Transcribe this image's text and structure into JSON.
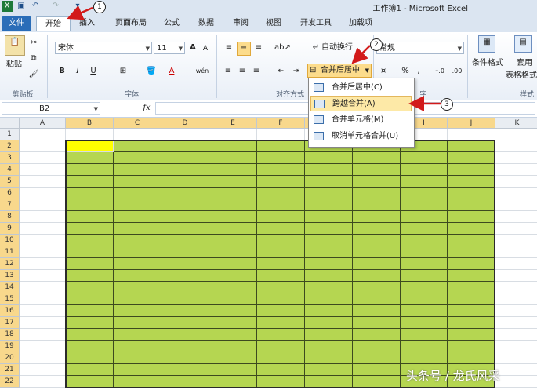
{
  "window": {
    "title": "工作簿1 - Microsoft Excel"
  },
  "tabs": [
    "文件",
    "开始",
    "插入",
    "页面布局",
    "公式",
    "数据",
    "审阅",
    "视图",
    "开发工具",
    "加载项"
  ],
  "clipboard": {
    "paste_label": "粘贴",
    "group_label": "剪贴板"
  },
  "font": {
    "name": "宋体",
    "size": "11",
    "group_label": "字体",
    "bold": "B",
    "italic": "I",
    "underline": "U",
    "grow": "A",
    "shrink": "A",
    "color_a": "A",
    "wen": "wén"
  },
  "alignment": {
    "wrap_label": "自动换行",
    "merge_label": "合并后居中",
    "group_label": "对齐方式"
  },
  "number": {
    "format": "常规",
    "percent": "%",
    "comma": ",",
    "group_label": "字"
  },
  "styles": {
    "cond_label": "条件格式",
    "table_label1": "套用",
    "table_label2": "表格格式",
    "group_label": "样式"
  },
  "formula_bar": {
    "name_box": "B2",
    "fx": "fx"
  },
  "columns": [
    "A",
    "B",
    "C",
    "D",
    "E",
    "F",
    "G",
    "H",
    "I",
    "J",
    "K"
  ],
  "rows": [
    "1",
    "2",
    "3",
    "4",
    "5",
    "6",
    "7",
    "8",
    "9",
    "10",
    "11",
    "12",
    "13",
    "14",
    "15",
    "16",
    "17",
    "18",
    "19",
    "20",
    "21",
    "22"
  ],
  "merge_menu": [
    {
      "label": "合并后居中(C)",
      "highlighted": false
    },
    {
      "label": "跨越合并(A)",
      "highlighted": true
    },
    {
      "label": "合并单元格(M)",
      "highlighted": false
    },
    {
      "label": "取消单元格合并(U)",
      "highlighted": false
    }
  ],
  "callouts": [
    "1",
    "2",
    "3"
  ],
  "watermark": "头条号 / 龙氏风采",
  "colors": {
    "fill": "#b5d651",
    "active_cell": "#ffff00",
    "file_tab": "#2a6db8",
    "arrow": "#d21a1a"
  }
}
